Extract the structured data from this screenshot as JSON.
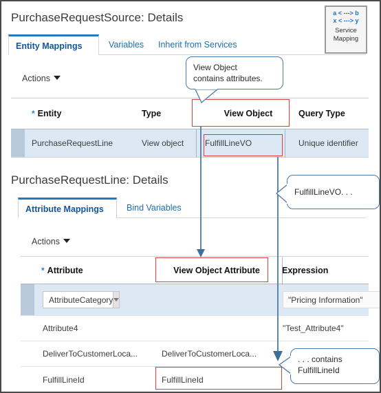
{
  "window": {
    "accent_blue": "#1f79c4",
    "highlight_red": "#e03a3a",
    "callout_border": "#4a7ba8",
    "selected_row_bg": "#dce9f5"
  },
  "service_mapping_badge": {
    "line1": "a < ---> b",
    "line2": "x < ---> y",
    "label_line1": "Service",
    "label_line2": "Mapping"
  },
  "source_panel": {
    "title": "PurchaseRequestSource: Details",
    "tabs": [
      {
        "label": "Entity Mappings",
        "active": true
      },
      {
        "label": "Variables",
        "active": false
      },
      {
        "label": "Inherit from Services",
        "active": false
      }
    ],
    "actions_label": "Actions",
    "table": {
      "columns": [
        {
          "label": "Entity",
          "required": true
        },
        {
          "label": "Type",
          "required": false
        },
        {
          "label": "View Object",
          "required": false
        },
        {
          "label": "Query Type",
          "required": false
        }
      ],
      "rows": [
        {
          "entity": "PurchaseRequestLine",
          "type": "View object",
          "view_object": "FulfillLineVO",
          "query_type": "Unique identifier",
          "selected": true
        }
      ]
    }
  },
  "line_panel": {
    "title": "PurchaseRequestLine: Details",
    "tabs": [
      {
        "label": "Attribute Mappings",
        "active": true
      },
      {
        "label": "Bind Variables",
        "active": false
      }
    ],
    "actions_label": "Actions",
    "table": {
      "columns": [
        {
          "label": "Attribute",
          "required": true
        },
        {
          "label": "View Object Attribute",
          "required": false
        },
        {
          "label": "Expression",
          "required": false
        }
      ],
      "rows": [
        {
          "attribute": "AttributeCategory",
          "attribute_is_dropdown": true,
          "view_object_attribute": "",
          "expression": "\"Pricing Information\"",
          "expression_is_field": true,
          "selected": true
        },
        {
          "attribute": "Attribute4",
          "attribute_is_dropdown": false,
          "view_object_attribute": "",
          "expression": "\"Test_Attribute4\"",
          "expression_is_field": false,
          "selected": false
        },
        {
          "attribute": "DeliverToCustomerLoca...",
          "attribute_is_dropdown": false,
          "view_object_attribute": "DeliverToCustomerLoca...",
          "expression": "",
          "expression_is_field": false,
          "selected": false
        },
        {
          "attribute": "FulfillLineId",
          "attribute_is_dropdown": false,
          "view_object_attribute": "FulfillLineId",
          "expression": "",
          "expression_is_field": false,
          "selected": false
        }
      ]
    }
  },
  "callouts": [
    {
      "id": "view-object-contains-attributes",
      "text": "View Object\ncontains attributes."
    },
    {
      "id": "fulfill-line-vo",
      "text": "FulfillLineVO. . ."
    },
    {
      "id": "contains-fulfill-line-id",
      "text": ". . . contains\nFulfillLineId"
    }
  ]
}
